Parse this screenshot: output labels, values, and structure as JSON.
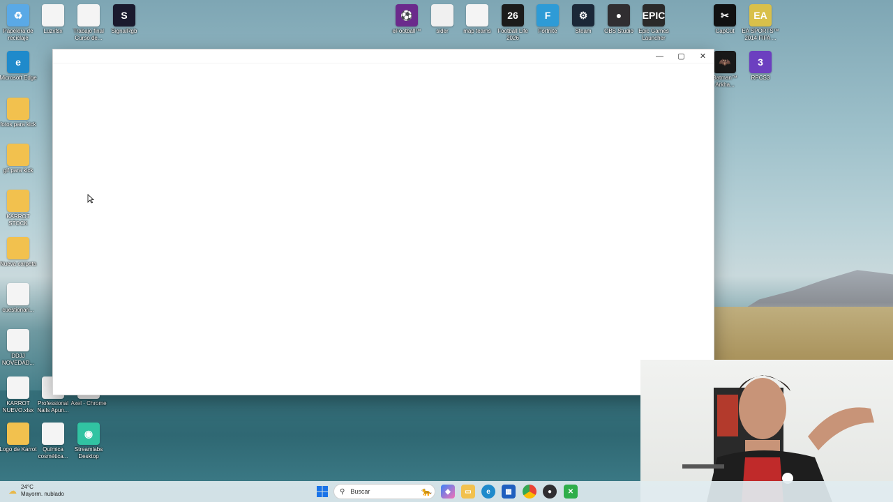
{
  "desktop": {
    "icons": [
      {
        "label": "Papelera de reciclaje",
        "glyph": "♻",
        "color": "#5aa9e6"
      },
      {
        "label": "Luzxfsx",
        "glyph": "",
        "color": "#f4f4f4"
      },
      {
        "label": "Trabajo final Curso de...",
        "glyph": "",
        "color": "#f4f4f4"
      },
      {
        "label": "SignalRgb",
        "glyph": "S",
        "color": "#1a1a2e"
      },
      {
        "label": "eFootball™",
        "glyph": "⚽",
        "color": "#6b2a8c"
      },
      {
        "label": "sider",
        "glyph": "",
        "color": "#f0f0f0"
      },
      {
        "label": "map teams",
        "glyph": "",
        "color": "#f4f4f4"
      },
      {
        "label": "Football Life 2026",
        "glyph": "26",
        "color": "#1b1b1b"
      },
      {
        "label": "Fortnite",
        "glyph": "F",
        "color": "#2e9bd6"
      },
      {
        "label": "Steam",
        "glyph": "⚙",
        "color": "#1b2838"
      },
      {
        "label": "OBS Studio",
        "glyph": "●",
        "color": "#302e31"
      },
      {
        "label": "Epic Games Launcher",
        "glyph": "EPIC",
        "color": "#2a2a2a"
      },
      {
        "label": "CapCut",
        "glyph": "✂",
        "color": "#111111"
      },
      {
        "label": "EA SPORTS™ 2014 FIFA ...",
        "glyph": "EA",
        "color": "#d9c04a"
      },
      {
        "label": "Microsoft Edge",
        "glyph": "e",
        "color": "#1f8acb"
      },
      {
        "label": "Batman™ Arkha...",
        "glyph": "🦇",
        "color": "#1a1a1a"
      },
      {
        "label": "RPCS3",
        "glyph": "3",
        "color": "#6c3fc0"
      },
      {
        "label": "fotos para kick",
        "glyph": "",
        "color": "#f2c14e"
      },
      {
        "label": "gif para kick",
        "glyph": "",
        "color": "#f2c14e"
      },
      {
        "label": "KARROT STOCK",
        "glyph": "",
        "color": "#f2c14e"
      },
      {
        "label": "Nueva carpeta",
        "glyph": "",
        "color": "#f2c14e"
      },
      {
        "label": "cuestionari...",
        "glyph": "",
        "color": "#f4f4f4"
      },
      {
        "label": "DDJJ NOVEDAD...",
        "glyph": "",
        "color": "#f4f4f4"
      },
      {
        "label": "KARROT NUEVO.xlsx",
        "glyph": "",
        "color": "#f4f4f4"
      },
      {
        "label": "Professional Nails Apun...",
        "glyph": "",
        "color": "#f4f4f4"
      },
      {
        "label": "Axel - Chrome",
        "glyph": "",
        "color": "#f4f4f4"
      },
      {
        "label": "Logo de Karrot",
        "glyph": "",
        "color": "#f2c14e"
      },
      {
        "label": "Química cosmética...",
        "glyph": "",
        "color": "#f4f4f4"
      },
      {
        "label": "Streamlabs Desktop",
        "glyph": "◉",
        "color": "#31c3a2"
      }
    ]
  },
  "window": {
    "minimize_glyph": "—",
    "maximize_glyph": "▢",
    "close_glyph": "✕"
  },
  "taskbar": {
    "weather_temp": "24°C",
    "weather_desc": "Mayorm. nublado",
    "search_placeholder": "Buscar",
    "apps": [
      "widgets-icon",
      "copilot-icon",
      "file-explorer-icon",
      "edge-icon",
      "store-icon",
      "chrome-icon",
      "obs-icon",
      "xbox-icon"
    ]
  }
}
